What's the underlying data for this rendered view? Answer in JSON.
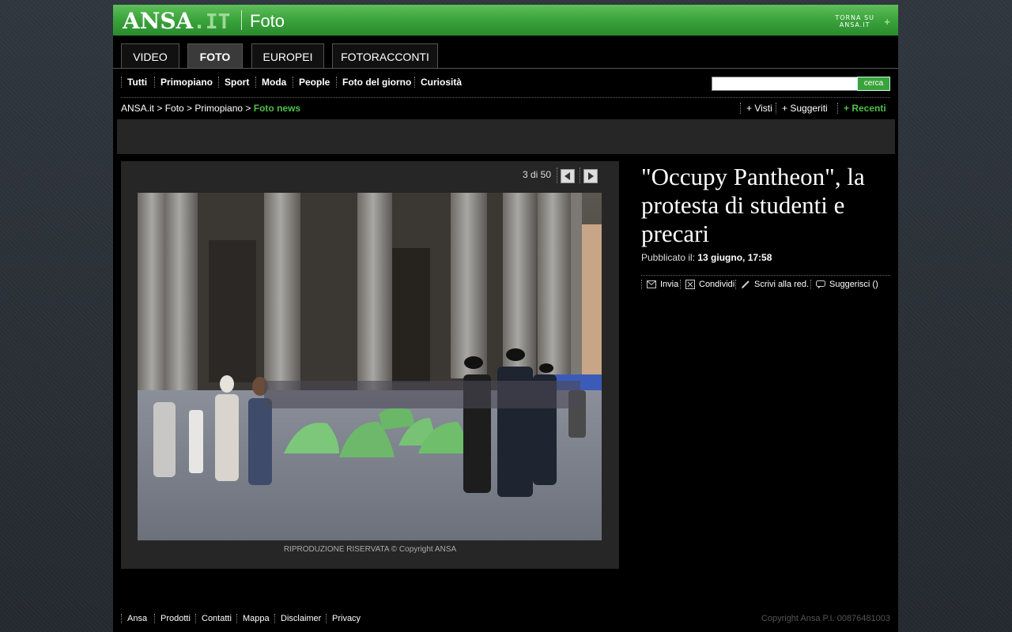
{
  "header": {
    "logo_main": "ANSA",
    "logo_suffix": ".IT",
    "section": "Foto",
    "back_line1": "TORNA SU",
    "back_line2": "ANSA.it",
    "back_icon": "+"
  },
  "tabs": [
    {
      "label": "VIDEO",
      "active": false
    },
    {
      "label": "FOTO",
      "active": true
    },
    {
      "label": "EUROPEI",
      "active": false
    },
    {
      "label": "FOTORACCONTI",
      "active": false
    }
  ],
  "subnav": [
    "Tutti",
    "Primopiano",
    "Sport",
    "Moda",
    "People",
    "Foto del giorno",
    "Curiosità"
  ],
  "search": {
    "value": "",
    "button": "cerca"
  },
  "breadcrumb": {
    "path": "ANSA.it > Foto > Primopiano > ",
    "current": "Foto news"
  },
  "viewlinks": [
    "+ Visti",
    "+ Suggeriti",
    "+ Recenti"
  ],
  "photo": {
    "counter": "3 di 50",
    "copyright": "RIPRODUZIONE RISERVATA © Copyright ANSA"
  },
  "article": {
    "title": "\"Occupy Pantheon\", la protesta di studenti e precari",
    "published_label": "Pubblicato il: ",
    "published_date": "13 giugno, 17:58"
  },
  "actions": [
    {
      "label": "Invia",
      "icon": "envelope-icon"
    },
    {
      "label": "Condividi",
      "icon": "share-icon"
    },
    {
      "label": "Scrivi alla red.",
      "icon": "pencil-icon"
    },
    {
      "label": "Suggerisci ()",
      "icon": "speech-bubble-icon"
    }
  ],
  "footer": {
    "links": [
      "Ansa",
      "Prodotti",
      "Contatti",
      "Mappa",
      "Disclaimer",
      "Privacy"
    ],
    "copyright": "Copyright Ansa P.I. 00876481003"
  },
  "colors": {
    "accent_green": "#3aa33b",
    "link_green": "#4fbf4a"
  }
}
